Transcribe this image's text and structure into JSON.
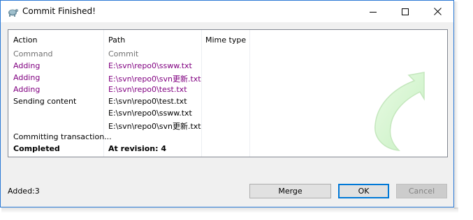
{
  "window": {
    "title": "Commit Finished!",
    "accent_color": "#2c7ad6"
  },
  "titlebar_buttons": {
    "minimize_icon": "minimize-icon",
    "maximize_icon": "maximize-icon",
    "close_icon": "close-icon"
  },
  "list": {
    "columns": [
      "Action",
      "Path",
      "Mime type"
    ],
    "rows": [
      {
        "action": "Command",
        "path": "Commit",
        "style": "gray"
      },
      {
        "action": "Adding",
        "path": "E:\\svn\\repo0\\ssww.txt",
        "style": "purple"
      },
      {
        "action": "Adding",
        "path": "E:\\svn\\repo0\\svn更新.txt",
        "style": "purple"
      },
      {
        "action": "Adding",
        "path": "E:\\svn\\repo0\\test.txt",
        "style": "purple"
      },
      {
        "action": "Sending content",
        "path": "E:\\svn\\repo0\\test.txt",
        "style": "black"
      },
      {
        "action": "",
        "path": "E:\\svn\\repo0\\ssww.txt",
        "style": "black"
      },
      {
        "action": "",
        "path": "E:\\svn\\repo0\\svn更新.txt",
        "style": "black"
      },
      {
        "action": "Committing transaction...",
        "path": "",
        "style": "black"
      },
      {
        "action": "Completed",
        "path": "At revision: 4",
        "style": "bold"
      }
    ],
    "colors": {
      "gray": "#707070",
      "purple": "#800080"
    }
  },
  "status": {
    "text": "Added:3"
  },
  "buttons": {
    "merge": "Merge",
    "ok": "OK",
    "cancel": "Cancel"
  }
}
